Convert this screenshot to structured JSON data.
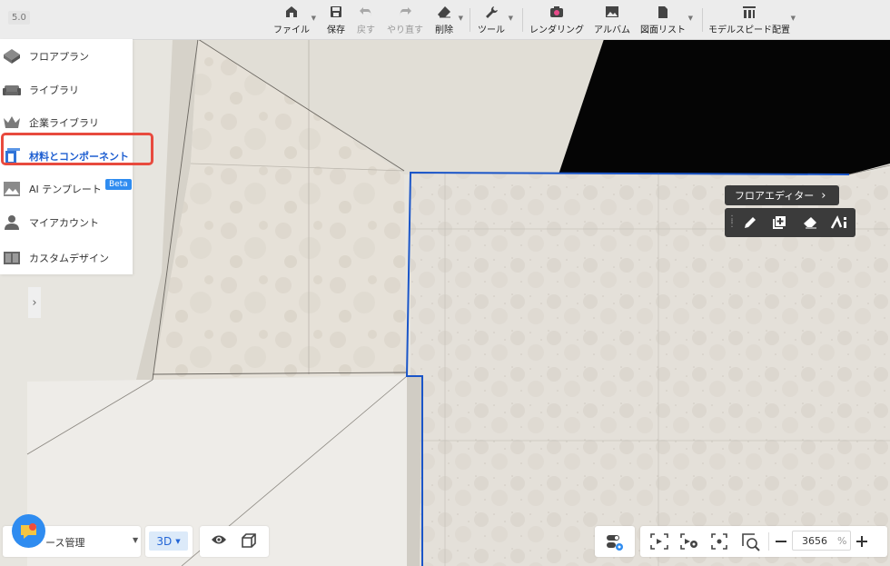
{
  "app": {
    "version": "5.0"
  },
  "toolbar": {
    "file": "ファイル",
    "save": "保存",
    "undo": "戻す",
    "redo": "やり直す",
    "delete": "削除",
    "tools": "ツール",
    "rendering": "レンダリング",
    "album": "アルバム",
    "drawing_list": "図面リスト",
    "model_speed_layout": "モデルスピード配置"
  },
  "sidebar": {
    "items": [
      {
        "label": "フロアプラン",
        "icon": "floorplan-icon"
      },
      {
        "label": "ライブラリ",
        "icon": "sofa-icon"
      },
      {
        "label": "企業ライブラリ",
        "icon": "crown-icon"
      },
      {
        "label": "材料とコンポーネント",
        "icon": "material-icon",
        "active": true
      },
      {
        "label": "AI テンプレート",
        "icon": "mountain-icon",
        "badge": "Beta"
      },
      {
        "label": "マイアカウント",
        "icon": "user-icon"
      },
      {
        "label": "カスタムデザイン",
        "icon": "cabinet-icon"
      }
    ]
  },
  "floor_editor": {
    "title": "フロアエディター"
  },
  "bottom": {
    "space_manage": "ース管理",
    "view_mode": "3D",
    "zoom_value": "3656",
    "zoom_unit": "%"
  },
  "colors": {
    "accent": "#2f8cf0",
    "active_text": "#1f5fd1",
    "highlight": "#e84a3e",
    "selection": "#1a55c8"
  }
}
